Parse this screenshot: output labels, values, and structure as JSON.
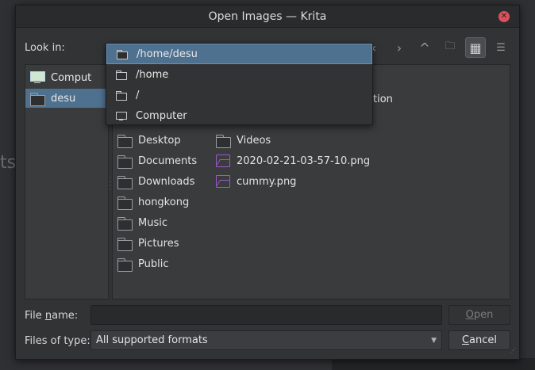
{
  "window": {
    "title": "Open Images — Krita",
    "close_symbol": "✕"
  },
  "background_app": {
    "text_fragment": "ts"
  },
  "lookin": {
    "label": "Look in:"
  },
  "toolbar": {
    "buttons": [
      {
        "icon": "back-icon",
        "glyph": "‹"
      },
      {
        "icon": "forward-icon",
        "glyph": "›"
      },
      {
        "icon": "up-icon",
        "glyph": "^"
      },
      {
        "icon": "new-folder-icon",
        "glyph": "🗀"
      },
      {
        "icon": "icon-view-icon",
        "glyph": "▦"
      },
      {
        "icon": "detail-view-icon",
        "glyph": "☰"
      }
    ]
  },
  "sidebar": {
    "items": [
      {
        "label": "Comput",
        "icon": "computer-icon"
      },
      {
        "label": "desu",
        "icon": "folder-icon",
        "selected": true
      }
    ]
  },
  "lookin_dropdown": {
    "items": [
      {
        "label": "/home/desu",
        "icon": "folder-icon",
        "selected": true
      },
      {
        "label": "/home",
        "icon": "folder-icon"
      },
      {
        "label": "/",
        "icon": "folder-icon"
      },
      {
        "label": "Computer",
        "icon": "monitor-icon"
      }
    ]
  },
  "files": {
    "partially_hidden_text": "tion",
    "column1": [
      "Desktop",
      "Documents",
      "Downloads",
      "hongkong",
      "Music",
      "Pictures",
      "Public"
    ],
    "column2": [
      {
        "name": "Videos",
        "type": "folder"
      },
      {
        "name": "2020-02-21-03-57-10.png",
        "type": "image"
      },
      {
        "name": "cummy.png",
        "type": "image"
      }
    ]
  },
  "file_name": {
    "label_pre": "File ",
    "label_mnemonic": "n",
    "label_post": "ame:",
    "value": "",
    "placeholder": ""
  },
  "file_type": {
    "label": "Files of type:",
    "selected": "All supported formats"
  },
  "buttons": {
    "open_mnemonic": "O",
    "open_rest": "pen",
    "cancel_mnemonic": "C",
    "cancel_rest": "ancel"
  },
  "colors": {
    "selection": "#4f7190",
    "close": "#d9515c",
    "image_icon": "#9b59c7"
  }
}
